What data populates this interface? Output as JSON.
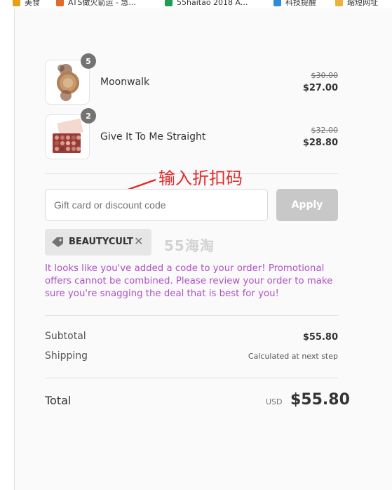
{
  "bookmarks": [
    {
      "label": "美食",
      "color": "#e6a017"
    },
    {
      "label": "ATS做火箭运 - 急...",
      "color": "#e06b2a"
    },
    {
      "label": "55haitao 2018 A...",
      "color": "#1f9d55"
    },
    {
      "label": "科技提醒",
      "color": "#2f8bd6"
    },
    {
      "label": "缩短网址",
      "color": "#e8b33a"
    }
  ],
  "items": [
    {
      "name": "Moonwalk",
      "qty": "5",
      "original_price": "$30.00",
      "price": "$27.00"
    },
    {
      "name": "Give It To Me Straight",
      "qty": "2",
      "original_price": "$32.00",
      "price": "$28.80"
    }
  ],
  "discount": {
    "placeholder": "Gift card or discount code",
    "apply_label": "Apply",
    "applied_code": "BEAUTYCULT",
    "annotation": "输入折扣码",
    "watermark": "55海淘",
    "message": "It looks like you've added a code to your order! Promotional offers cannot be combined. Please review your order to make sure you're snagging the deal that is best for you!"
  },
  "summary": {
    "subtotal_label": "Subtotal",
    "subtotal_value": "$55.80",
    "shipping_label": "Shipping",
    "shipping_value": "Calculated at next step",
    "total_label": "Total",
    "currency": "USD",
    "total_value": "$55.80"
  },
  "colors": {
    "promo_text": "#b04fc6",
    "annotation": "#e22a2a",
    "apply_disabled": "#c8c8c8"
  }
}
